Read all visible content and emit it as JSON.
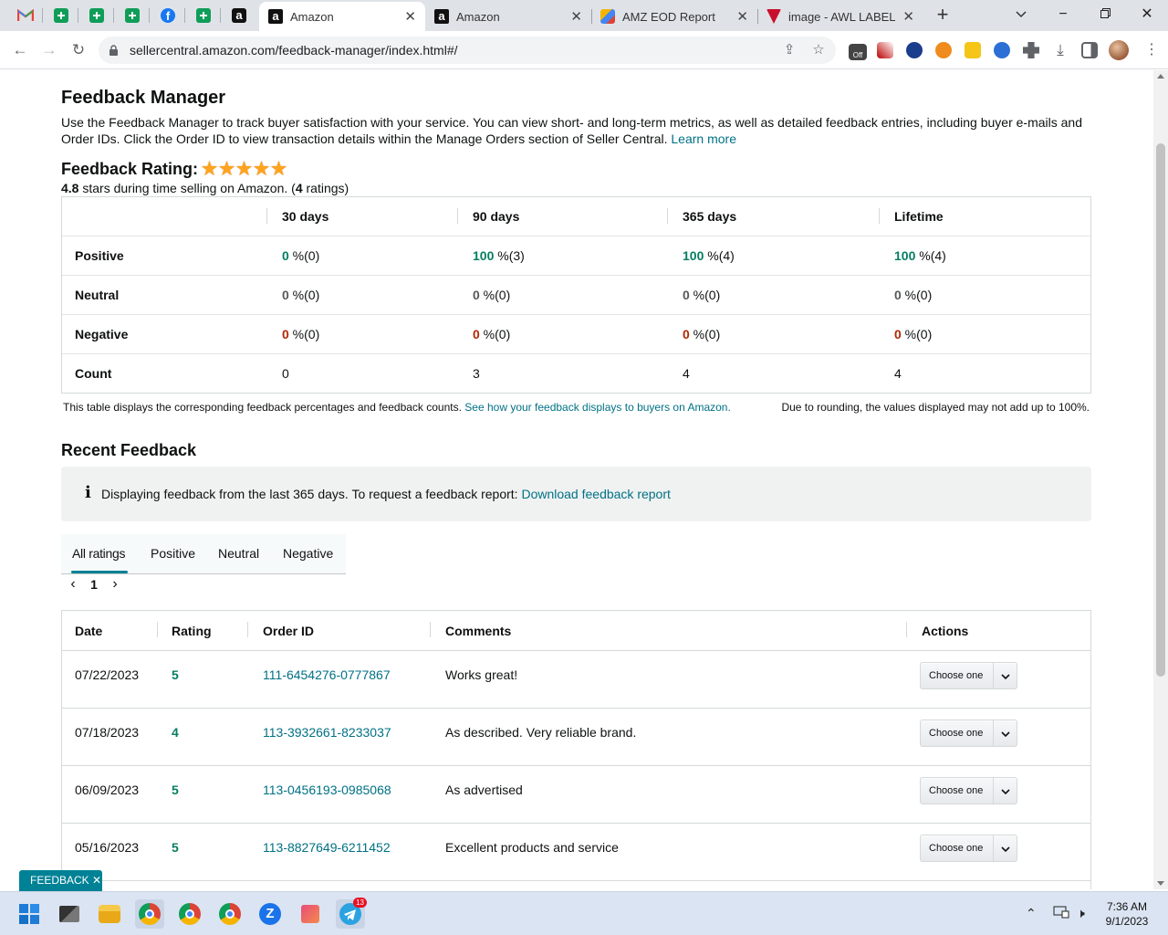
{
  "browser": {
    "tabs": [
      {
        "title": "Amazon",
        "active": true
      },
      {
        "title": "Amazon",
        "active": false
      },
      {
        "title": "AMZ EOD Report",
        "active": false
      },
      {
        "title": "image - AWL LABEL",
        "active": false
      }
    ],
    "url": "sellercentral.amazon.com/feedback-manager/index.html#/",
    "extension_badge": "Off"
  },
  "page": {
    "title": "Feedback Manager",
    "intro": "Use the Feedback Manager to track buyer satisfaction with your service. You can view short- and long-term metrics, as well as detailed feedback entries, including buyer e-mails and Order IDs. Click the Order ID to view transaction details within the Manage Orders section of Seller Central.",
    "learn_more": "Learn more",
    "rating_title": "Feedback Rating:",
    "rating_stars": 5,
    "rating_value": "4.8",
    "rating_text_mid": " stars during time selling on Amazon. (",
    "rating_count": "4",
    "rating_text_end": " ratings)",
    "summary": {
      "columns": [
        "30 days",
        "90 days",
        "365 days",
        "Lifetime"
      ],
      "rows": [
        {
          "label": "Positive",
          "cells": [
            [
              "0",
              " %(0)"
            ],
            [
              "100",
              " %(3)"
            ],
            [
              "100",
              " %(4)"
            ],
            [
              "100",
              " %(4)"
            ]
          ]
        },
        {
          "label": "Neutral",
          "cells": [
            [
              "0",
              " %(0)"
            ],
            [
              "0",
              " %(0)"
            ],
            [
              "0",
              " %(0)"
            ],
            [
              "0",
              " %(0)"
            ]
          ]
        },
        {
          "label": "Negative",
          "cells": [
            [
              "0",
              " %(0)"
            ],
            [
              "0",
              " %(0)"
            ],
            [
              "0",
              " %(0)"
            ],
            [
              "0",
              " %(0)"
            ]
          ]
        },
        {
          "label": "Count",
          "cells": [
            [
              "0",
              ""
            ],
            [
              "3",
              ""
            ],
            [
              "4",
              ""
            ],
            [
              "4",
              ""
            ]
          ]
        }
      ]
    },
    "table_note": "This table displays the corresponding feedback percentages and feedback counts.",
    "table_note_link": "See how your feedback displays to buyers on Amazon.",
    "rounding_note": "Due to rounding, the values displayed may not add up to 100%.",
    "recent_title": "Recent Feedback",
    "info_text": "Displaying feedback from the last 365 days. To request a feedback report:",
    "info_link": "Download feedback report",
    "filter_tabs": [
      "All ratings",
      "Positive",
      "Neutral",
      "Negative"
    ],
    "page_number": "1",
    "feedback_table": {
      "headers": [
        "Date",
        "Rating",
        "Order ID",
        "Comments",
        "Actions"
      ],
      "rows": [
        {
          "date": "07/22/2023",
          "rating": "5",
          "order": "111-6454276-0777867",
          "comment": "Works great!",
          "action": "Choose one"
        },
        {
          "date": "07/18/2023",
          "rating": "4",
          "order": "113-3932661-8233037",
          "comment": "As described. Very reliable brand.",
          "action": "Choose one"
        },
        {
          "date": "06/09/2023",
          "rating": "5",
          "order": "113-0456193-0985068",
          "comment": "As advertised",
          "action": "Choose one"
        },
        {
          "date": "05/16/2023",
          "rating": "5",
          "order": "113-8827649-6211452",
          "comment": "Excellent products and service",
          "action": "Choose one"
        }
      ]
    },
    "feedback_pill": "FEEDBACK ✕"
  },
  "taskbar": {
    "time": "7:36 AM",
    "date": "9/1/2023",
    "telegram_badge": "13"
  },
  "colors": {
    "link": "#007185",
    "positive": "#067d62",
    "negative": "#b12704",
    "accent": "#008296",
    "star": "#ffa41c"
  }
}
